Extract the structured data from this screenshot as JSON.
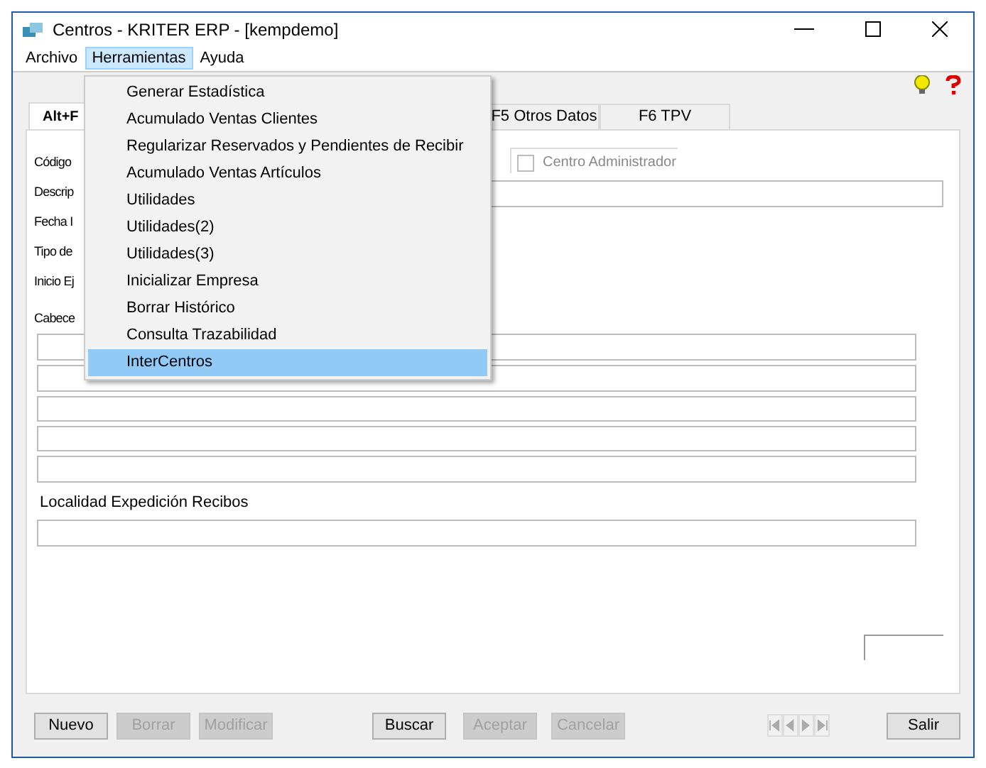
{
  "window": {
    "title": "Centros - KRITER ERP -  [kempdemo]"
  },
  "menu_bar": [
    {
      "label": "Archivo",
      "selected": false
    },
    {
      "label": "Herramientas",
      "selected": true
    },
    {
      "label": "Ayuda",
      "selected": false
    }
  ],
  "dropdown": [
    {
      "label": "Generar Estadística",
      "selected": false
    },
    {
      "label": "Acumulado Ventas Clientes",
      "selected": false
    },
    {
      "label": "Regularizar Reservados y Pendientes de Recibir",
      "selected": false
    },
    {
      "label": "Acumulado Ventas Artículos",
      "selected": false
    },
    {
      "label": "Utilidades",
      "selected": false
    },
    {
      "label": "Utilidades(2)",
      "selected": false
    },
    {
      "label": "Utilidades(3)",
      "selected": false
    },
    {
      "label": "Inicializar Empresa",
      "selected": false
    },
    {
      "label": "Borrar Histórico",
      "selected": false
    },
    {
      "label": "Consulta Trazabilidad",
      "selected": false
    },
    {
      "label": "InterCentros",
      "selected": true
    }
  ],
  "tabs": [
    {
      "label": "Alt+F",
      "selected": true
    },
    {
      "label": "F5 Otros Datos",
      "selected": false
    },
    {
      "label": "F6 TPV",
      "selected": false
    }
  ],
  "form": {
    "labels": [
      "Código",
      "Descrip",
      "Fecha I",
      "Tipo de",
      "Inicio Ej",
      "Cabece"
    ],
    "centro_administrador": {
      "label": "Centro Administrador",
      "checked": false
    },
    "localidad_label": "Localidad Expedición Recibos"
  },
  "buttons": [
    {
      "label": "Nuevo",
      "disabled": false
    },
    {
      "label": "Borrar",
      "disabled": true
    },
    {
      "label": "Modificar",
      "disabled": true
    },
    {
      "label": "Buscar",
      "disabled": false
    },
    {
      "label": "Aceptar",
      "disabled": true
    },
    {
      "label": "Cancelar",
      "disabled": true
    },
    {
      "label": "Salir",
      "disabled": false
    }
  ]
}
